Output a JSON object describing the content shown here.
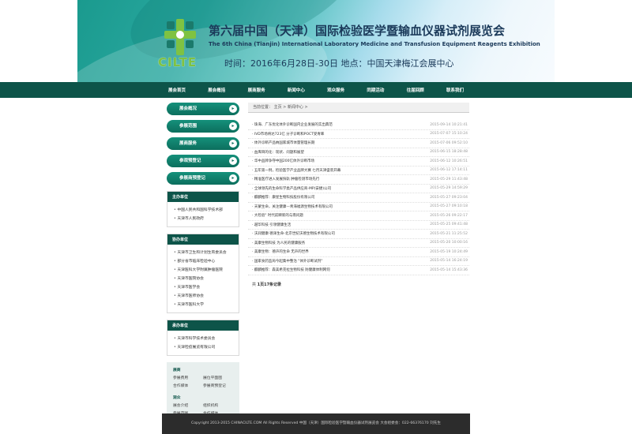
{
  "banner": {
    "logo_text": "CILTE",
    "title_cn": "第六届中国（天津）国际检验医学暨输血仪器试剂展览会",
    "title_en": "The 6th China (Tianjin) International Laboratory Medicine and Transfusion Equipment Reagents Exhibition",
    "info": "时间：2016年6月28日-30日    地点：中国天津梅江会展中心"
  },
  "nav": [
    "展会首页",
    "展会概括",
    "展商服务",
    "新闻中心",
    "观众服务",
    "同期活动",
    "往届回顾",
    "联系我们"
  ],
  "sidebar": {
    "buttons": [
      "展会概况",
      "参展范围",
      "展商服务",
      "参观预登记",
      "参展商预登记"
    ],
    "organizer": {
      "title": "主办单位",
      "items": [
        "中国人民共和国科学技术部",
        "天津市人民政府"
      ]
    },
    "cosponsor": {
      "title": "协办单位",
      "items": [
        "天津市卫生和计划生育委员会",
        "部分省市临床检验中心",
        "天津医科大学附属肿瘤医院",
        "天津市医院协会",
        "天津市医学会",
        "天津市医师协会",
        "天津市医科大学"
      ]
    },
    "host": {
      "title": "承办单位",
      "items": [
        "天津市科学技术委员会",
        "天津检疫展览有限公司"
      ]
    },
    "links": {
      "exhibit_title": "展商",
      "exhibit": [
        "参展费用",
        "展位平面图",
        "合作媒体",
        "参展商预登记"
      ],
      "visitor_title": "观众",
      "visitor": [
        "展会介绍",
        "组织机构",
        "参展范围",
        "合作媒体"
      ]
    }
  },
  "main": {
    "breadcrumb": "当前位置：    主页 > 新闻中心 >",
    "news": [
      {
        "title": "· 珠海、广东优化体外诊断国内企业发展的实出典范",
        "date": "2015-09-14 10:21:41"
      },
      {
        "title": "· IVD市场将达723亿 分子诊断和POCT受青睐",
        "date": "2015-07-07 15:10:24"
      },
      {
        "title": "· 体外诊断产品纳国家城市体量管理长期",
        "date": "2015-07-06 09:52:10"
      },
      {
        "title": "· 血库目的化：现状、问题和展望",
        "date": "2015-06-15 18:28:48"
      },
      {
        "title": "· 华中品牌争夺中国200亿体外诊断市场",
        "date": "2015-06-12 10:26:51"
      },
      {
        "title": "· 五年第一例，检验医学产业品牌大赛 七月天津盛装开幕",
        "date": "2015-06-12 17:14:11"
      },
      {
        "title": "· 精准医疗进入发展快轨 肿瘤检测市场先行",
        "date": "2015-05-29 11:43:48"
      },
      {
        "title": "· 全球领先的生命科学类产品供应商-MP(安捷)公司",
        "date": "2015-05-29 14:59:29"
      },
      {
        "title": "· 麒麟推荐：康星生物科技股份有限公司",
        "date": "2015-05-27 09:23:04"
      },
      {
        "title": "· 天蒙生命，关注健康—青海福源生物技术有限公司",
        "date": "2015-05-27 09:10:18"
      },
      {
        "title": "· 大检验\" 时代前瞬新的与南问题",
        "date": "2015-05-26 09:22:17"
      },
      {
        "title": "· 越华科技 引领健康生活",
        "date": "2015-05-25 09:41:48"
      },
      {
        "title": "· 沃润健康·德泽生命-北京世纪沃德生物技术有限公司",
        "date": "2015-05-21 11:25:52"
      },
      {
        "title": "· 美康生物科技 为人民的健康服务",
        "date": "2015-05-20 10:00:16"
      },
      {
        "title": "· 美康生物：德声的生命 无声的世界",
        "date": "2015-05-19 10:24:49"
      },
      {
        "title": "· 国家食药监局今起集中整治 \"体外诊断试剂\"",
        "date": "2015-05-14 16:24:19"
      },
      {
        "title": "· 麒麟推荐：森美希克拉生物科技 防健康体制网何",
        "date": "2015-05-14 15:43:36"
      }
    ],
    "pager": {
      "prefix": "共",
      "pages": "1页17条记录"
    }
  },
  "footer": "Copyright 2013-2015 CHINACILTE.COM All Rights Reserved    中国（天津）国际检验医学暨输血仪器试剂展览会 大会组委会：022-66376170 刘先生"
}
